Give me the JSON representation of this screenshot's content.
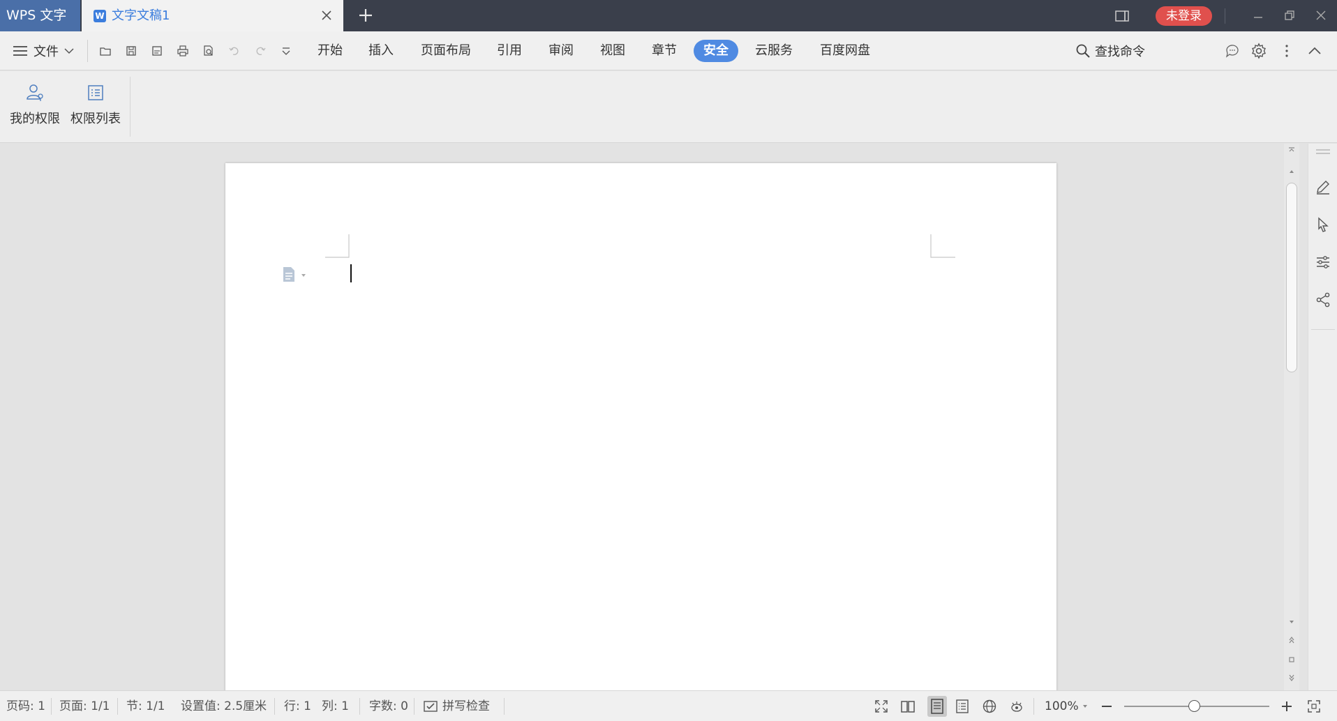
{
  "titlebar": {
    "app_name": "WPS 文字",
    "doc_tab_title": "文字文稿1",
    "login_label": "未登录"
  },
  "menu": {
    "file_label": "文件",
    "items": [
      "开始",
      "插入",
      "页面布局",
      "引用",
      "审阅",
      "视图",
      "章节",
      "安全",
      "云服务",
      "百度网盘"
    ],
    "active_item": "安全",
    "search_label": "查找命令"
  },
  "ribbon": {
    "buttons": [
      {
        "label": "我的权限",
        "icon": "user-permission-icon"
      },
      {
        "label": "权限列表",
        "icon": "permission-list-icon"
      }
    ]
  },
  "status": {
    "page_code": "页码: 1",
    "pages": "页面: 1/1",
    "section": "节: 1/1",
    "setting": "设置值: 2.5厘米",
    "row": "行: 1",
    "col": "列: 1",
    "word_count": "字数: 0",
    "spell_check": "拼写检查",
    "zoom": "100%"
  },
  "colors": {
    "titlebar_bg": "#3a3f4b",
    "app_tab_bg": "#4a6fa8",
    "accent": "#4f8ae2",
    "login_bg": "#e0504d",
    "doc_title": "#3b7ddd"
  }
}
